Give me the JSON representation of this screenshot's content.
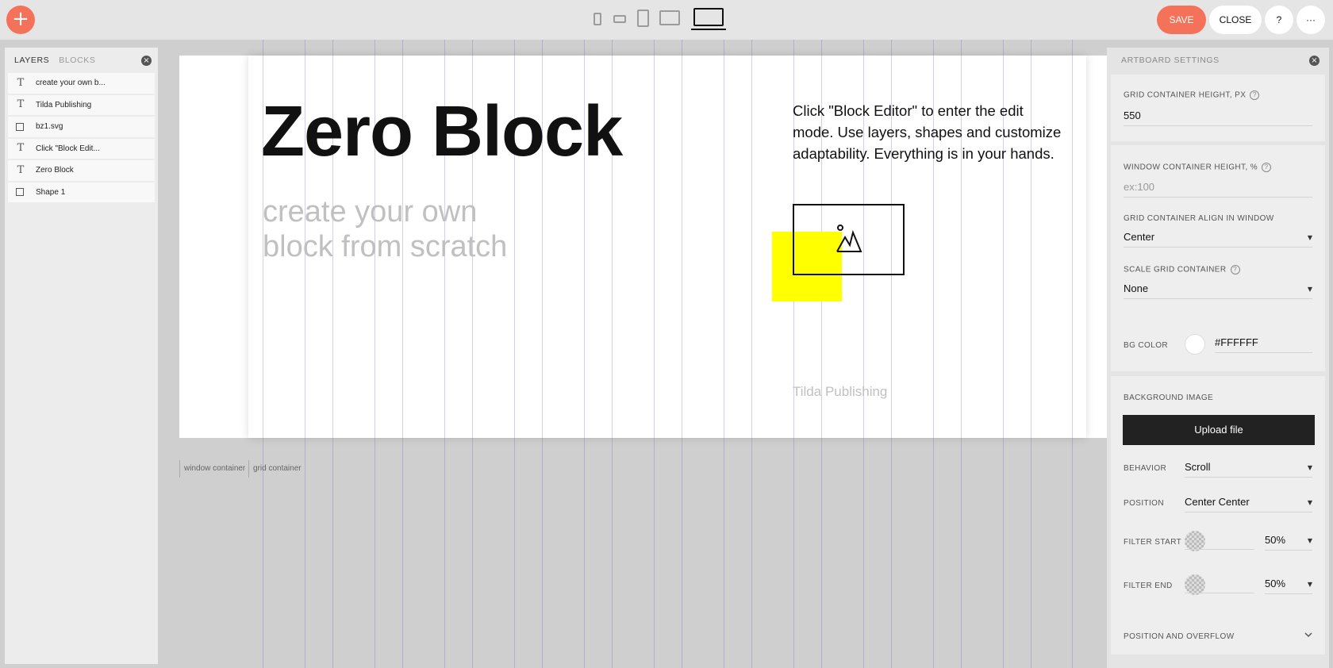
{
  "topbar": {
    "add_icon": "plus-icon",
    "devices": [
      "phone-portrait",
      "phone-landscape",
      "tablet-portrait",
      "tablet-landscape",
      "desktop"
    ],
    "active_device": "desktop",
    "save_label": "SAVE",
    "close_label": "CLOSE",
    "help_label": "?",
    "more_label": "···",
    "accent_color": "#f4715a"
  },
  "layers_panel": {
    "tab_layers": "LAYERS",
    "tab_blocks": "BLOCKS",
    "close_icon": "×",
    "items": [
      {
        "label": "create your own b...",
        "icon": "T"
      },
      {
        "label": "Tilda Publishing",
        "icon": "T"
      },
      {
        "label": "bz1.svg",
        "icon": "▣"
      },
      {
        "label": "Click \"Block Edit...",
        "icon": "T"
      },
      {
        "label": "Zero Block",
        "icon": "T"
      },
      {
        "label": "Shape 1",
        "icon": ""
      }
    ]
  },
  "canvas": {
    "headline": "Zero Block",
    "subheading": "create your own block from scratch",
    "description": "Click \"Block Editor\" to enter the edit mode. Use layers, shapes and customize adaptability. Everything is in your hands.",
    "footer_text": "Tilda Publishing",
    "shape_color": "#ffff00",
    "window_container_label": "window container",
    "grid_container_label": "grid container"
  },
  "settings_panel": {
    "title": "ARTBOARD SETTINGS",
    "close_icon": "×",
    "grid_height_label": "GRID CONTAINER HEIGHT, PX",
    "grid_height_value": "550",
    "window_height_label": "WINDOW CONTAINER HEIGHT, %",
    "window_height_placeholder": "ex:100",
    "align_label": "GRID CONTAINER ALIGN IN WINDOW",
    "align_value": "Center",
    "scale_label": "SCALE GRID CONTAINER",
    "scale_value": "None",
    "bg_color_label": "BG COLOR",
    "bg_color_value": "#FFFFFF",
    "bg_image_label": "BACKGROUND IMAGE",
    "upload_label": "Upload file",
    "behavior_label": "BEHAVIOR",
    "behavior_value": "Scroll",
    "position_label": "POSITION",
    "position_value": "Center Center",
    "filter_start_label": "FILTER START",
    "filter_start_value": "50%",
    "filter_end_label": "FILTER END",
    "filter_end_value": "50%",
    "overflow_label": "POSITION AND OVERFLOW",
    "help_icon": "?",
    "dropdown_icon": "▼"
  }
}
